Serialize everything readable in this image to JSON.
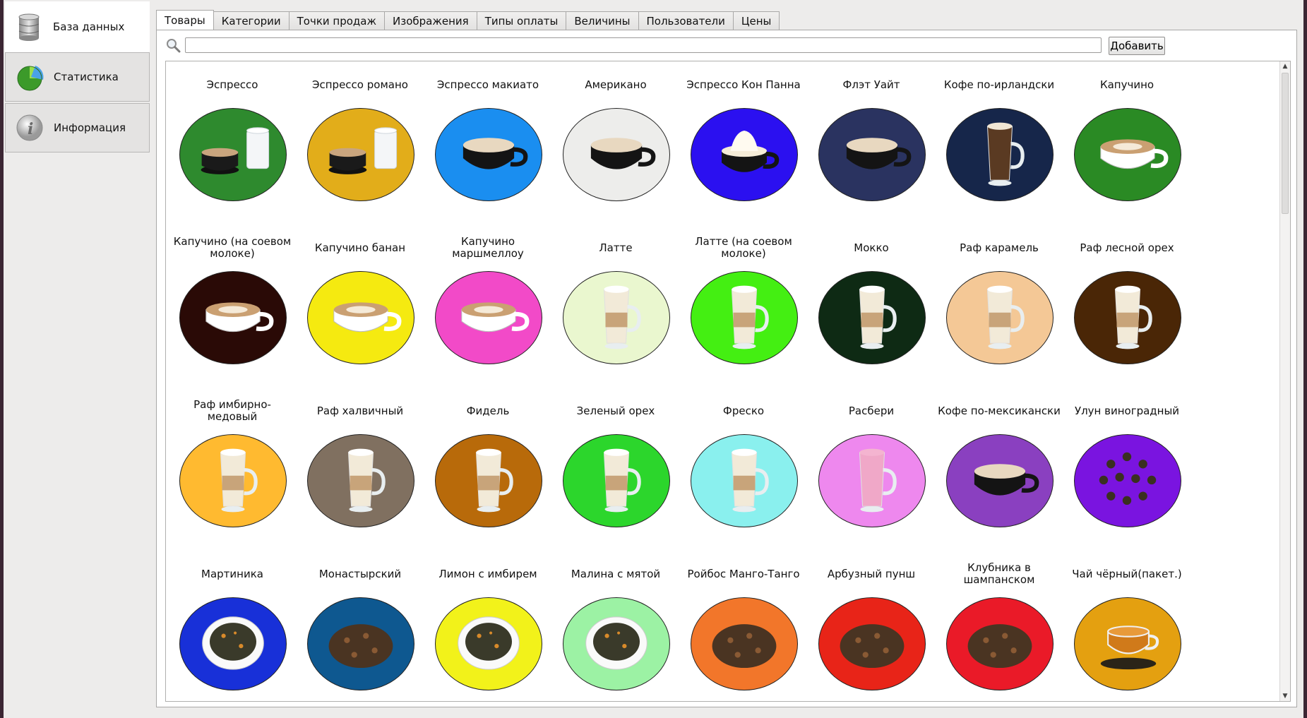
{
  "sidebar": {
    "items": [
      {
        "label": "База данных",
        "icon": "database-icon",
        "active": true
      },
      {
        "label": "Статистика",
        "icon": "pie-chart-icon",
        "active": false
      },
      {
        "label": "Информация",
        "icon": "info-icon",
        "active": false
      }
    ]
  },
  "tabs": [
    {
      "label": "Товары",
      "active": true
    },
    {
      "label": "Категории"
    },
    {
      "label": "Точки продаж"
    },
    {
      "label": "Изображения"
    },
    {
      "label": "Типы оплаты"
    },
    {
      "label": "Величины"
    },
    {
      "label": "Пользователи"
    },
    {
      "label": "Цены"
    }
  ],
  "search": {
    "value": "",
    "placeholder": ""
  },
  "add_button_label": "Добавить",
  "products": [
    {
      "name": "Эспрессо",
      "bg": "#2e8a2e",
      "kind": "espresso"
    },
    {
      "name": "Эспрессо романо",
      "bg": "#e2ad1a",
      "kind": "espresso"
    },
    {
      "name": "Эспрессо макиато",
      "bg": "#1a8ef0",
      "kind": "cup"
    },
    {
      "name": "Американо",
      "bg": "#ededeb",
      "kind": "cup"
    },
    {
      "name": "Эспрессо Кон Панна",
      "bg": "#2b10f0",
      "kind": "cup-cream"
    },
    {
      "name": "Флэт Уайт",
      "bg": "#2a3360",
      "kind": "cup"
    },
    {
      "name": "Кофе по-ирландски",
      "bg": "#16264a",
      "kind": "glass-dark"
    },
    {
      "name": "Капучино",
      "bg": "#2a8a24",
      "kind": "cup-white"
    },
    {
      "name": "Капучино (на соевом молоке)",
      "bg": "#2a0a06",
      "kind": "cup-white"
    },
    {
      "name": "Капучино банан",
      "bg": "#f5ea10",
      "kind": "cup-white"
    },
    {
      "name": "Капучино маршмеллоу",
      "bg": "#f24ac8",
      "kind": "cup-white"
    },
    {
      "name": "Латте",
      "bg": "#eaf7cf",
      "kind": "glass"
    },
    {
      "name": "Латте (на соевом молоке)",
      "bg": "#44ef12",
      "kind": "glass"
    },
    {
      "name": "Мокко",
      "bg": "#0e2a14",
      "kind": "glass"
    },
    {
      "name": "Раф карамель",
      "bg": "#f4c896",
      "kind": "glass"
    },
    {
      "name": "Раф лесной орех",
      "bg": "#4a2606",
      "kind": "glass"
    },
    {
      "name": "Раф имбирно-медовый",
      "bg": "#ffba30",
      "kind": "glass"
    },
    {
      "name": "Раф халвичный",
      "bg": "#807060",
      "kind": "glass"
    },
    {
      "name": "Фидель",
      "bg": "#b86a0a",
      "kind": "glass"
    },
    {
      "name": "Зеленый орех",
      "bg": "#2cd62c",
      "kind": "glass"
    },
    {
      "name": "Фреско",
      "bg": "#8af0ee",
      "kind": "glass"
    },
    {
      "name": "Расбери",
      "bg": "#ee88ee",
      "kind": "glass-pink"
    },
    {
      "name": "Кофе по-мексикански",
      "bg": "#8a40c0",
      "kind": "cup"
    },
    {
      "name": "Улун виноградный",
      "bg": "#7a14e0",
      "kind": "tea-balls"
    },
    {
      "name": "Мартиника",
      "bg": "#1830d8",
      "kind": "tea-bowl"
    },
    {
      "name": "Монастырский",
      "bg": "#0e5890",
      "kind": "tea-heap"
    },
    {
      "name": "Лимон с имбирем",
      "bg": "#f2f21a",
      "kind": "tea-bowl"
    },
    {
      "name": "Малина с мятой",
      "bg": "#9cf2a4",
      "kind": "tea-bowl"
    },
    {
      "name": "Ройбос Манго-Танго",
      "bg": "#f2762a",
      "kind": "tea-heap"
    },
    {
      "name": "Арбузный пунш",
      "bg": "#e82418",
      "kind": "tea-heap"
    },
    {
      "name": "Клубника в шампанском",
      "bg": "#ea1a28",
      "kind": "tea-heap"
    },
    {
      "name": "Чай чёрный(пакет.)",
      "bg": "#e4a010",
      "kind": "tea-cup"
    }
  ]
}
